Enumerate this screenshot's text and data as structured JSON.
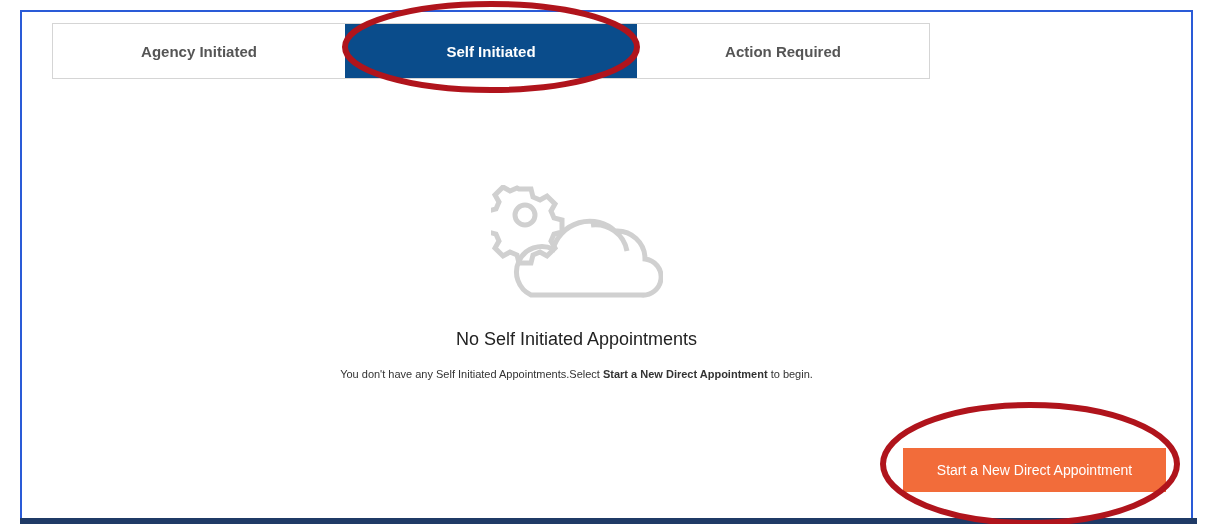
{
  "tabs": [
    {
      "label": "Agency Initiated",
      "selected": false
    },
    {
      "label": "Self Initiated",
      "selected": true
    },
    {
      "label": "Action Required",
      "selected": false
    }
  ],
  "empty_state": {
    "heading": "No Self Initiated Appointments",
    "message": "You don't have any Self Initiated Appointments.Select **Start a New Direct Appointment** to begin."
  },
  "button": {
    "label": "Start a New Direct Appointment"
  }
}
